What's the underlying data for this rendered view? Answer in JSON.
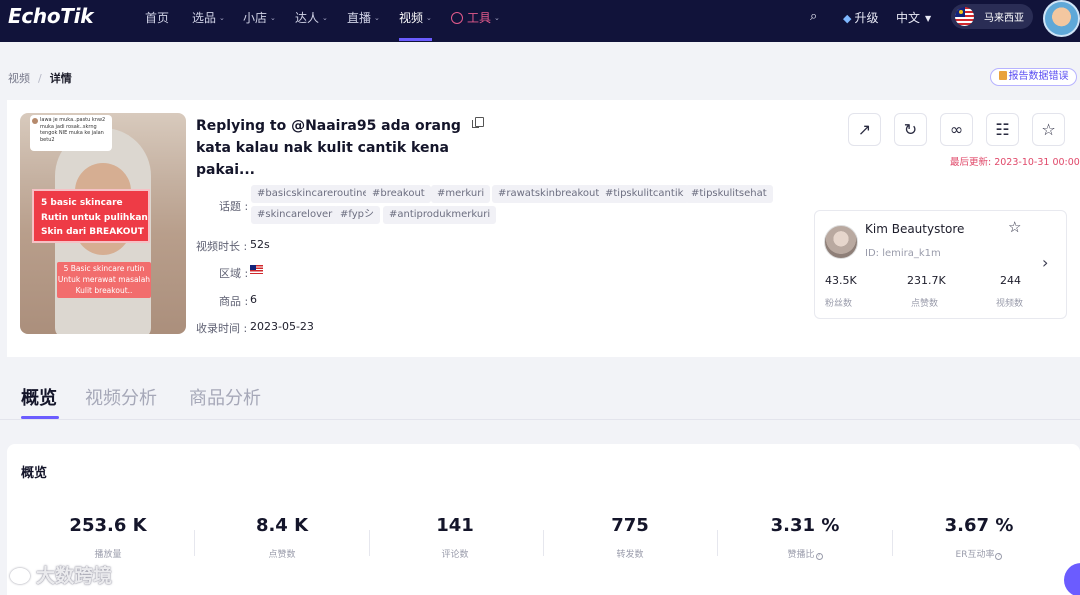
{
  "nav": {
    "logo": "EchoTik",
    "items": [
      {
        "label": "首页",
        "has_menu": false
      },
      {
        "label": "选品",
        "has_menu": true
      },
      {
        "label": "小店",
        "has_menu": true
      },
      {
        "label": "达人",
        "has_menu": true
      },
      {
        "label": "直播",
        "has_menu": true
      },
      {
        "label": "视频",
        "has_menu": true,
        "active": true
      },
      {
        "label": "工具",
        "has_menu": true
      }
    ],
    "search_icon": "search-icon",
    "upgrade_label": "升级",
    "language": "中文",
    "region": "马来西亚",
    "chevron": "⌄",
    "caret": "▼"
  },
  "breadcrumb": {
    "parent": "视频",
    "separator": "/",
    "current": "详情"
  },
  "report_label": "报告数据错误",
  "video": {
    "title": "Replying to @Naaira95 ada orang kata kalau nak kulit cantik kena pakai...",
    "topic_label": "话题 :",
    "tags": [
      "#basicskincareroutine",
      "#breakout",
      "#merkuri",
      "#rawatskinbreakout",
      "#tipskulitcantik",
      "#tipskulitsehat",
      "#skincarelover",
      "#fypシ",
      "#antiprodukmerkuri"
    ],
    "duration_label": "视频时长 :",
    "duration": "52s",
    "region_label": "区域 :",
    "region_flag": "malaysia-flag",
    "products_label": "商品 :",
    "products": "6",
    "collected_label": "收录时间 :",
    "collected": "2023-05-23",
    "updated": "最后更新: 2023-10-31 00:00"
  },
  "thumbnail": {
    "comment_text": "lawa je muka..pastu knw2 muka jadi rosak..skrng tengok NIE muka ke jalan betu2",
    "overlay_main": [
      "5 basic skincare",
      "Rutin untuk pulihkan",
      "Skin dari BREAKOUT"
    ],
    "overlay_sub": [
      "5 Basic skincare rutin",
      "Untuk merawat masalah",
      "Kulit breakout.."
    ]
  },
  "actions": [
    "external-link-icon",
    "refresh-icon",
    "link-icon",
    "qr-code-icon",
    "star-icon"
  ],
  "creator": {
    "name": "Kim Beautystore",
    "id": "ID: lemira_k1m",
    "stats": [
      {
        "value": "43.5K",
        "label": "粉丝数"
      },
      {
        "value": "231.7K",
        "label": "点赞数"
      },
      {
        "value": "244",
        "label": "视频数"
      }
    ]
  },
  "tabs": [
    "概览",
    "视频分析",
    "商品分析"
  ],
  "overview": {
    "title": "概览",
    "metrics": [
      {
        "value": "253.6 K",
        "label": "播放量",
        "help": false
      },
      {
        "value": "8.4 K",
        "label": "点赞数",
        "help": false
      },
      {
        "value": "141",
        "label": "评论数",
        "help": false
      },
      {
        "value": "775",
        "label": "转发数",
        "help": false
      },
      {
        "value": "3.31 %",
        "label": "赞播比",
        "help": true
      },
      {
        "value": "3.67 %",
        "label": "ER互动率",
        "help": true
      }
    ]
  },
  "watermark": "大数跨境",
  "colors": {
    "nav_bg": "#11133a",
    "accent": "#6b5cff",
    "update_red": "#e0496a"
  }
}
